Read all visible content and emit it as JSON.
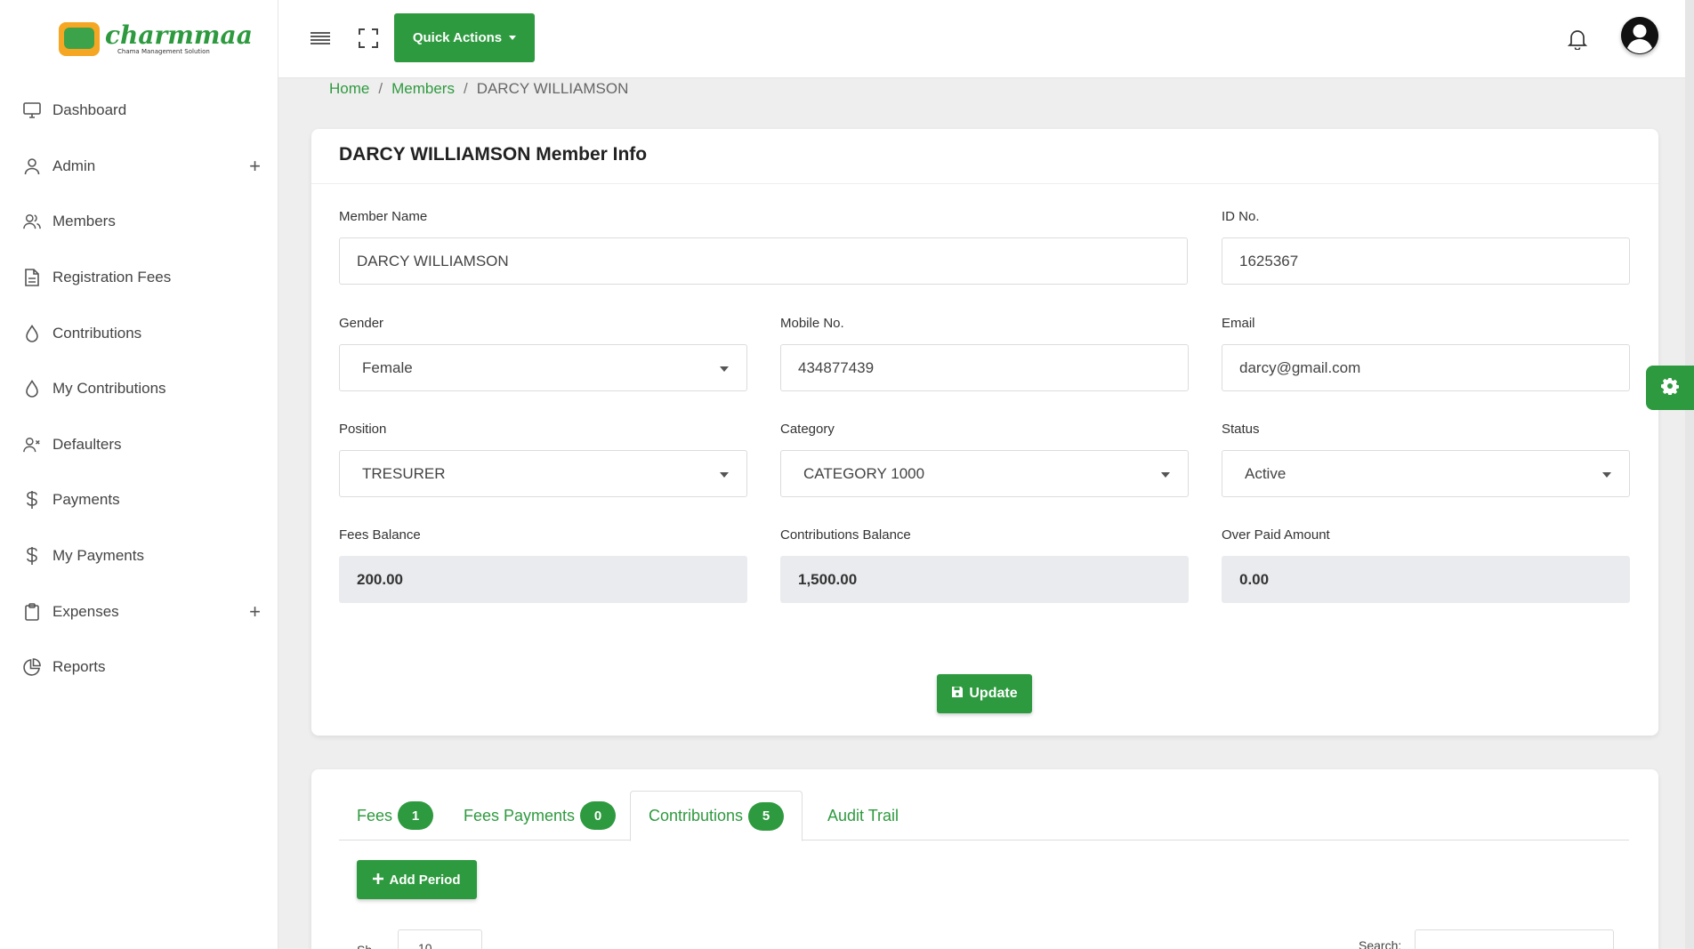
{
  "brand": {
    "name": "charmmaa",
    "tagline": "Chama Management Solution"
  },
  "sidebar": {
    "items": [
      {
        "label": "Dashboard",
        "icon": "monitor-icon",
        "expandable": false
      },
      {
        "label": "Admin",
        "icon": "user-icon",
        "expandable": true
      },
      {
        "label": "Members",
        "icon": "users-icon",
        "expandable": false
      },
      {
        "label": "Registration Fees",
        "icon": "document-icon",
        "expandable": false
      },
      {
        "label": "Contributions",
        "icon": "drop-icon",
        "expandable": false
      },
      {
        "label": "My Contributions",
        "icon": "drop-icon",
        "expandable": false
      },
      {
        "label": "Defaulters",
        "icon": "user-x-icon",
        "expandable": false
      },
      {
        "label": "Payments",
        "icon": "dollar-icon",
        "expandable": false
      },
      {
        "label": "My Payments",
        "icon": "dollar-icon",
        "expandable": false
      },
      {
        "label": "Expenses",
        "icon": "clipboard-icon",
        "expandable": true
      },
      {
        "label": "Reports",
        "icon": "pie-chart-icon",
        "expandable": false
      }
    ],
    "expand_symbol": "+"
  },
  "topbar": {
    "quick_actions_label": "Quick Actions"
  },
  "breadcrumb": {
    "home": "Home",
    "members": "Members",
    "current": "DARCY WILLIAMSON",
    "separator": "/"
  },
  "member_card": {
    "title": "DARCY WILLIAMSON Member Info",
    "fields": {
      "member_name": {
        "label": "Member Name",
        "value": "DARCY WILLIAMSON"
      },
      "id_no": {
        "label": "ID No.",
        "value": "1625367"
      },
      "gender": {
        "label": "Gender",
        "value": "Female"
      },
      "mobile": {
        "label": "Mobile No.",
        "value": "434877439"
      },
      "email": {
        "label": "Email",
        "value": "darcy@gmail.com"
      },
      "position": {
        "label": "Position",
        "value": "TRESURER"
      },
      "category": {
        "label": "Category",
        "value": "CATEGORY 1000"
      },
      "status": {
        "label": "Status",
        "value": "Active"
      },
      "fees_balance": {
        "label": "Fees Balance",
        "value": "200.00"
      },
      "contributions_balance": {
        "label": "Contributions Balance",
        "value": "1,500.00"
      },
      "over_paid": {
        "label": "Over Paid Amount",
        "value": "0.00"
      }
    },
    "update_label": "Update"
  },
  "tabs": [
    {
      "label": "Fees",
      "count": "1"
    },
    {
      "label": "Fees Payments",
      "count": "0"
    },
    {
      "label": "Contributions",
      "count": "5",
      "active": true
    },
    {
      "label": "Audit Trail"
    }
  ],
  "contributions_panel": {
    "add_period_label": "Add Period",
    "show_label": "Sh",
    "page_length": "10",
    "search_label": "Search:"
  },
  "colors": {
    "accent": "#2e9a3f",
    "background": "#eeeeee"
  }
}
